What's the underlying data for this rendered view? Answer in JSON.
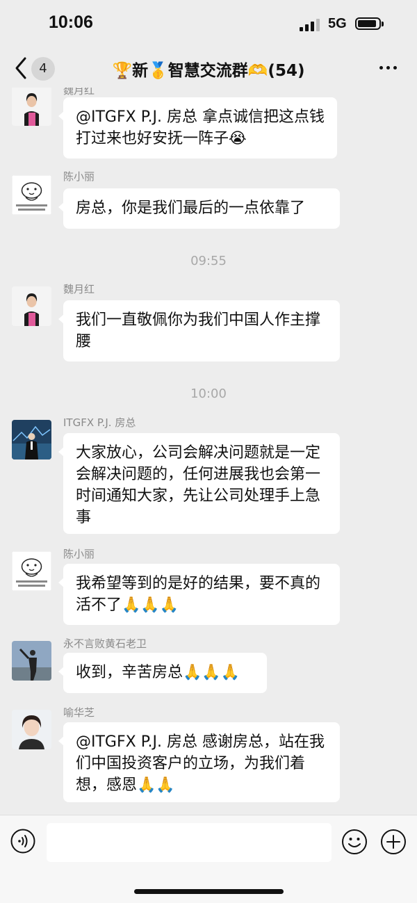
{
  "status": {
    "time": "10:06",
    "network": "5G"
  },
  "nav": {
    "badge": "4",
    "title": "🏆新🥇智慧交流群🫶(54)"
  },
  "messages": [
    {
      "sender": "魏月红",
      "text": "@ITGFX P.J. 房总 拿点诚信把这点钱打过来也好安抚一阵子😭"
    },
    {
      "sender": "陈小丽",
      "text": "房总，你是我们最后的一点依靠了",
      "avatar_caption": "你会闪闪发光世界\n差不差一分钱一分货"
    },
    {
      "sender": "魏月红",
      "text": "我们一直敬佩你为我们中国人作主撑腰"
    },
    {
      "sender": "ITGFX P.J. 房总",
      "text": "大家放心，公司会解决问题就是一定会解决问题的，任何进展我也会第一时间通知大家，先让公司处理手上急事"
    },
    {
      "sender": "陈小丽",
      "text": "我希望等到的是好的结果，要不真的活不了🙏🙏🙏",
      "avatar_caption": "你会闪闪发光世界\n差不差一分钱一分货"
    },
    {
      "sender": "永不言败黄石老卫",
      "text": "收到，辛苦房总🙏🙏🙏"
    },
    {
      "sender": "喻华芝",
      "text": "@ITGFX P.J. 房总 感谢房总，站在我们中国投资客户的立场，为我们着想，感恩🙏🙏"
    }
  ],
  "timestamps": [
    "09:55",
    "10:00"
  ],
  "icons": {
    "back": "chevron-left-icon",
    "more": "more-dots-icon",
    "voice": "voice-icon",
    "emoji": "emoji-icon",
    "plus": "plus-icon"
  },
  "colors": {
    "background": "#ededed",
    "bubble": "#ffffff",
    "meta_text": "#8a8a8a"
  }
}
